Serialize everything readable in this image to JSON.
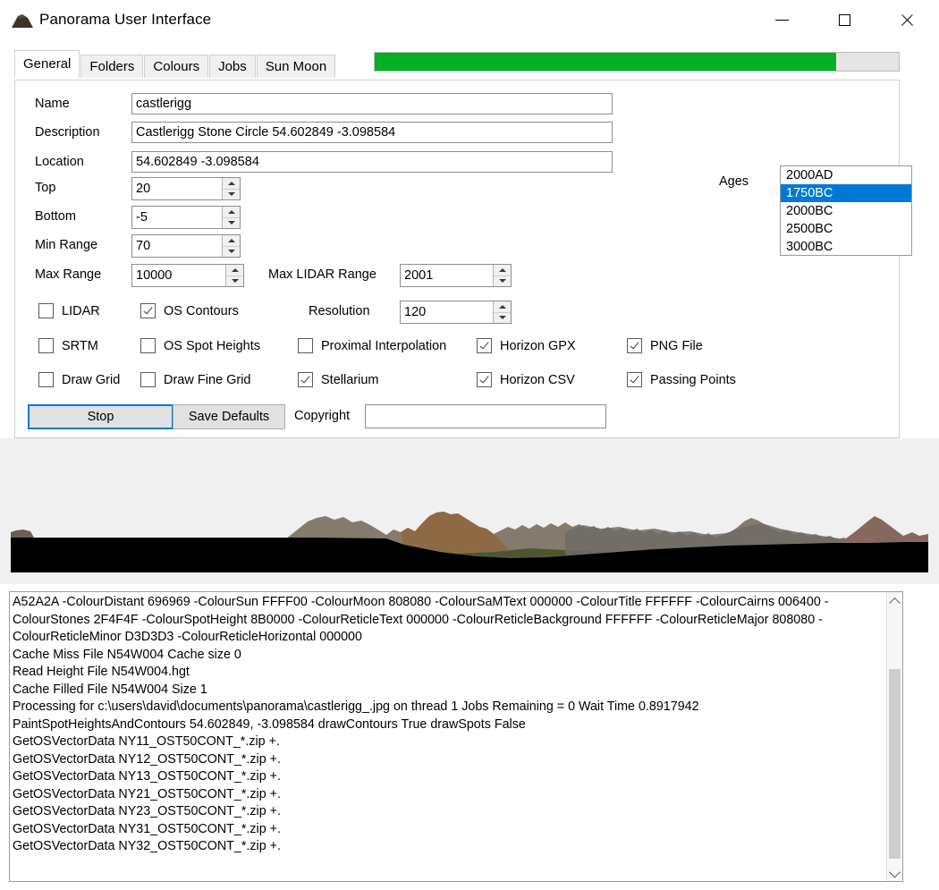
{
  "window": {
    "title": "Panorama User Interface",
    "icon": "mountain-icon",
    "controls": {
      "minimize": "minimize-icon",
      "maximize": "maximize-icon",
      "close": "close-icon"
    }
  },
  "tabs": [
    {
      "label": "General",
      "active": true
    },
    {
      "label": "Folders",
      "active": false
    },
    {
      "label": "Colours",
      "active": false
    },
    {
      "label": "Jobs",
      "active": false
    },
    {
      "label": "Sun Moon",
      "active": false
    }
  ],
  "progress": {
    "percent": 88,
    "fill_color": "#06b025",
    "track_color": "#e6e6e6"
  },
  "general": {
    "fields": [
      {
        "label": "Name",
        "value": "castlerigg"
      },
      {
        "label": "Description",
        "value": "Castlerigg Stone Circle 54.602849 -3.098584"
      },
      {
        "label": "Location",
        "value": "54.602849 -3.098584"
      }
    ],
    "spinners": [
      {
        "label": "Top",
        "value": "20"
      },
      {
        "label": "Bottom",
        "value": "-5"
      },
      {
        "label": "Min Range",
        "value": "70"
      },
      {
        "label": "Max Range",
        "value": "10000"
      },
      {
        "label": "Max LIDAR Range",
        "value": "2001"
      },
      {
        "label": "Resolution",
        "value": "120"
      }
    ],
    "ages": {
      "label": "Ages",
      "options": [
        "2000AD",
        "1750BC",
        "2000BC",
        "2500BC",
        "3000BC"
      ],
      "selected": "1750BC",
      "selected_color": "#0078d7"
    },
    "checkboxes": [
      {
        "label": "LIDAR",
        "checked": false
      },
      {
        "label": "OS Contours",
        "checked": true
      },
      {
        "label": "SRTM",
        "checked": false
      },
      {
        "label": "OS Spot Heights",
        "checked": false
      },
      {
        "label": "Proximal Interpolation",
        "checked": false
      },
      {
        "label": "Horizon GPX",
        "checked": true
      },
      {
        "label": "PNG File",
        "checked": true
      },
      {
        "label": "Draw Grid",
        "checked": false
      },
      {
        "label": "Draw Fine Grid",
        "checked": false
      },
      {
        "label": "Stellarium",
        "checked": true
      },
      {
        "label": "Horizon CSV",
        "checked": true
      },
      {
        "label": "Passing Points",
        "checked": true
      }
    ],
    "buttons": {
      "stop": "Stop",
      "save_defaults": "Save Defaults"
    },
    "copyright": {
      "label": "Copyright",
      "value": ""
    }
  },
  "log": {
    "text": "A52A2A -ColourDistant 696969 -ColourSun FFFF00 -ColourMoon 808080 -ColourSaMText 000000 -ColourTitle FFFFFF -ColourCairns 006400 -ColourStones 2F4F4F -ColourSpotHeight 8B0000 -ColourReticleText 000000 -ColourReticleBackground FFFFFF -ColourReticleMajor 808080 -ColourReticleMinor D3D3D3 -ColourReticleHorizontal 000000\nCache Miss File N54W004 Cache size 0\nRead Height File N54W004.hgt\nCache Filled File N54W004 Size 1\nProcessing for c:\\users\\david\\documents\\panorama\\castlerigg_.jpg on thread 1 Jobs Remaining = 0 Wait Time 0.8917942\nPaintSpotHeightsAndContours 54.602849, -3.098584 drawContours True drawSpots False\nGetOSVectorData NY11_OST50CONT_*.zip +.\nGetOSVectorData NY12_OST50CONT_*.zip +.\nGetOSVectorData NY13_OST50CONT_*.zip +.\nGetOSVectorData NY21_OST50CONT_*.zip +.\nGetOSVectorData NY23_OST50CONT_*.zip +.\nGetOSVectorData NY31_OST50CONT_*.zip +.\nGetOSVectorData NY32_OST50CONT_*.zip +.",
    "scrollbar": {
      "up_arrow": "chevron-up-icon",
      "down_arrow": "chevron-down-icon"
    }
  },
  "panorama": {
    "description": "rendered terrain horizon panorama",
    "sky_color": "#f0f0f0",
    "ground_color": "#000000"
  }
}
